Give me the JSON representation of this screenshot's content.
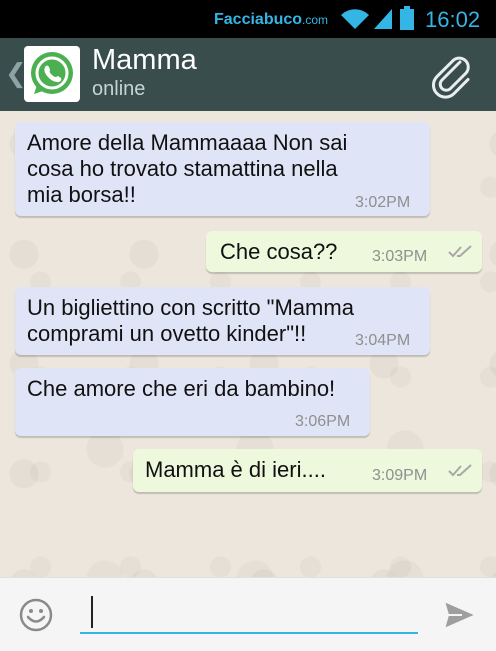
{
  "status_bar": {
    "carrier_watermark": "Facciabuco",
    "carrier_suffix": ".com",
    "time": "16:02",
    "icons": [
      "wifi-icon",
      "signal-icon",
      "battery-icon"
    ]
  },
  "header": {
    "contact_name": "Mamma",
    "contact_status": "online",
    "icons": [
      "back-icon",
      "whatsapp-logo-icon",
      "paperclip-icon"
    ]
  },
  "messages": [
    {
      "direction": "in",
      "lines": [
        "Amore della Mammaaaa Non sai",
        "cosa ho trovato stamattina nella",
        "mia borsa!!"
      ],
      "time": "3:02PM"
    },
    {
      "direction": "out",
      "lines": [
        "Che cosa??"
      ],
      "time": "3:03PM",
      "status": "read"
    },
    {
      "direction": "in",
      "lines": [
        "Un bigliettino con scritto \"Mamma",
        "comprami un ovetto kinder\"!!"
      ],
      "time": "3:04PM"
    },
    {
      "direction": "in",
      "lines": [
        "Che amore che eri da bambino!"
      ],
      "time": "3:06PM"
    },
    {
      "direction": "out",
      "lines": [
        "Mamma è di ieri...."
      ],
      "time": "3:09PM",
      "status": "read"
    }
  ],
  "input": {
    "value": "",
    "icons": [
      "emoji-icon",
      "send-icon"
    ]
  },
  "colors": {
    "status_accent": "#33b5e5",
    "header_bg": "#394d4d",
    "incoming_bubble": "#dfe4f7",
    "outgoing_bubble": "#eef8dd",
    "whatsapp_green": "#4caf50"
  }
}
